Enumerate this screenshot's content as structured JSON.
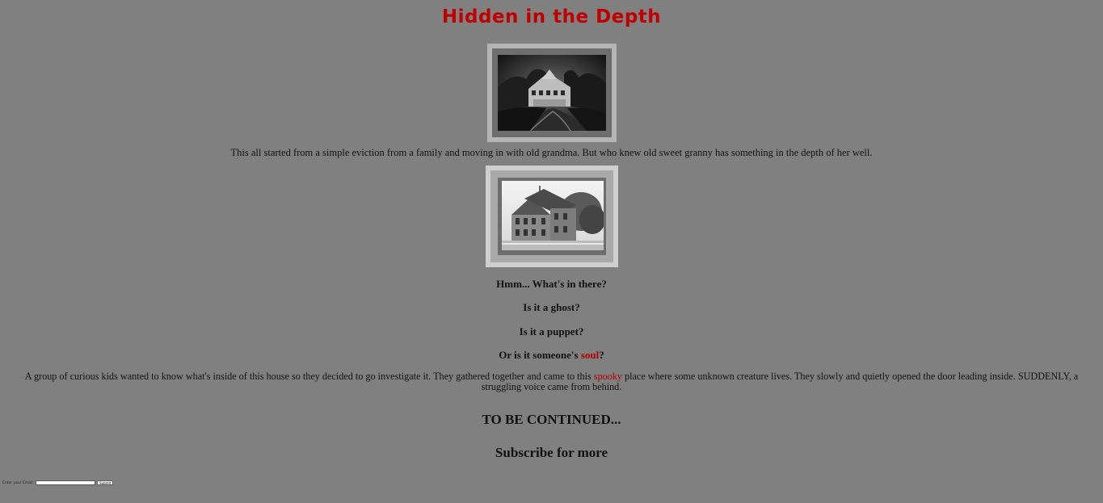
{
  "page": {
    "title": "Hidden in the Depth"
  },
  "images": {
    "first": {
      "icon": "dark-haunted-house-photo"
    },
    "second": {
      "icon": "old-two-story-house-photo"
    }
  },
  "intro": "This all started from a simple eviction from a family and moving in with old grandma. But who knew old sweet granny has something in the depth of her well.",
  "questions": {
    "q1": "Hmm... What's in there?",
    "q2": "Is it a ghost?",
    "q3": "Is it a puppet?",
    "q4_before": "Or is it someone's ",
    "q4_highlight": "soul",
    "q4_after": "?"
  },
  "story": {
    "before": "A group of curious kids wanted to know what's inside of this house so they decided to go investigate it. They gathered together and came to this ",
    "highlight": "spooky",
    "after": " place where some unknown creature lives. They slowly and quietly opened the door leading inside. SUDDENLY, a struggling voice came from behind."
  },
  "to_be_continued": "TO BE CONTINUED...",
  "subscribe_heading": "Subscribe for more",
  "form": {
    "label": "Enter your Email:",
    "email_value": "",
    "submit_label": "Submit"
  },
  "colors": {
    "background": "#808080",
    "title": "#c00000",
    "highlight": "#b00000"
  }
}
